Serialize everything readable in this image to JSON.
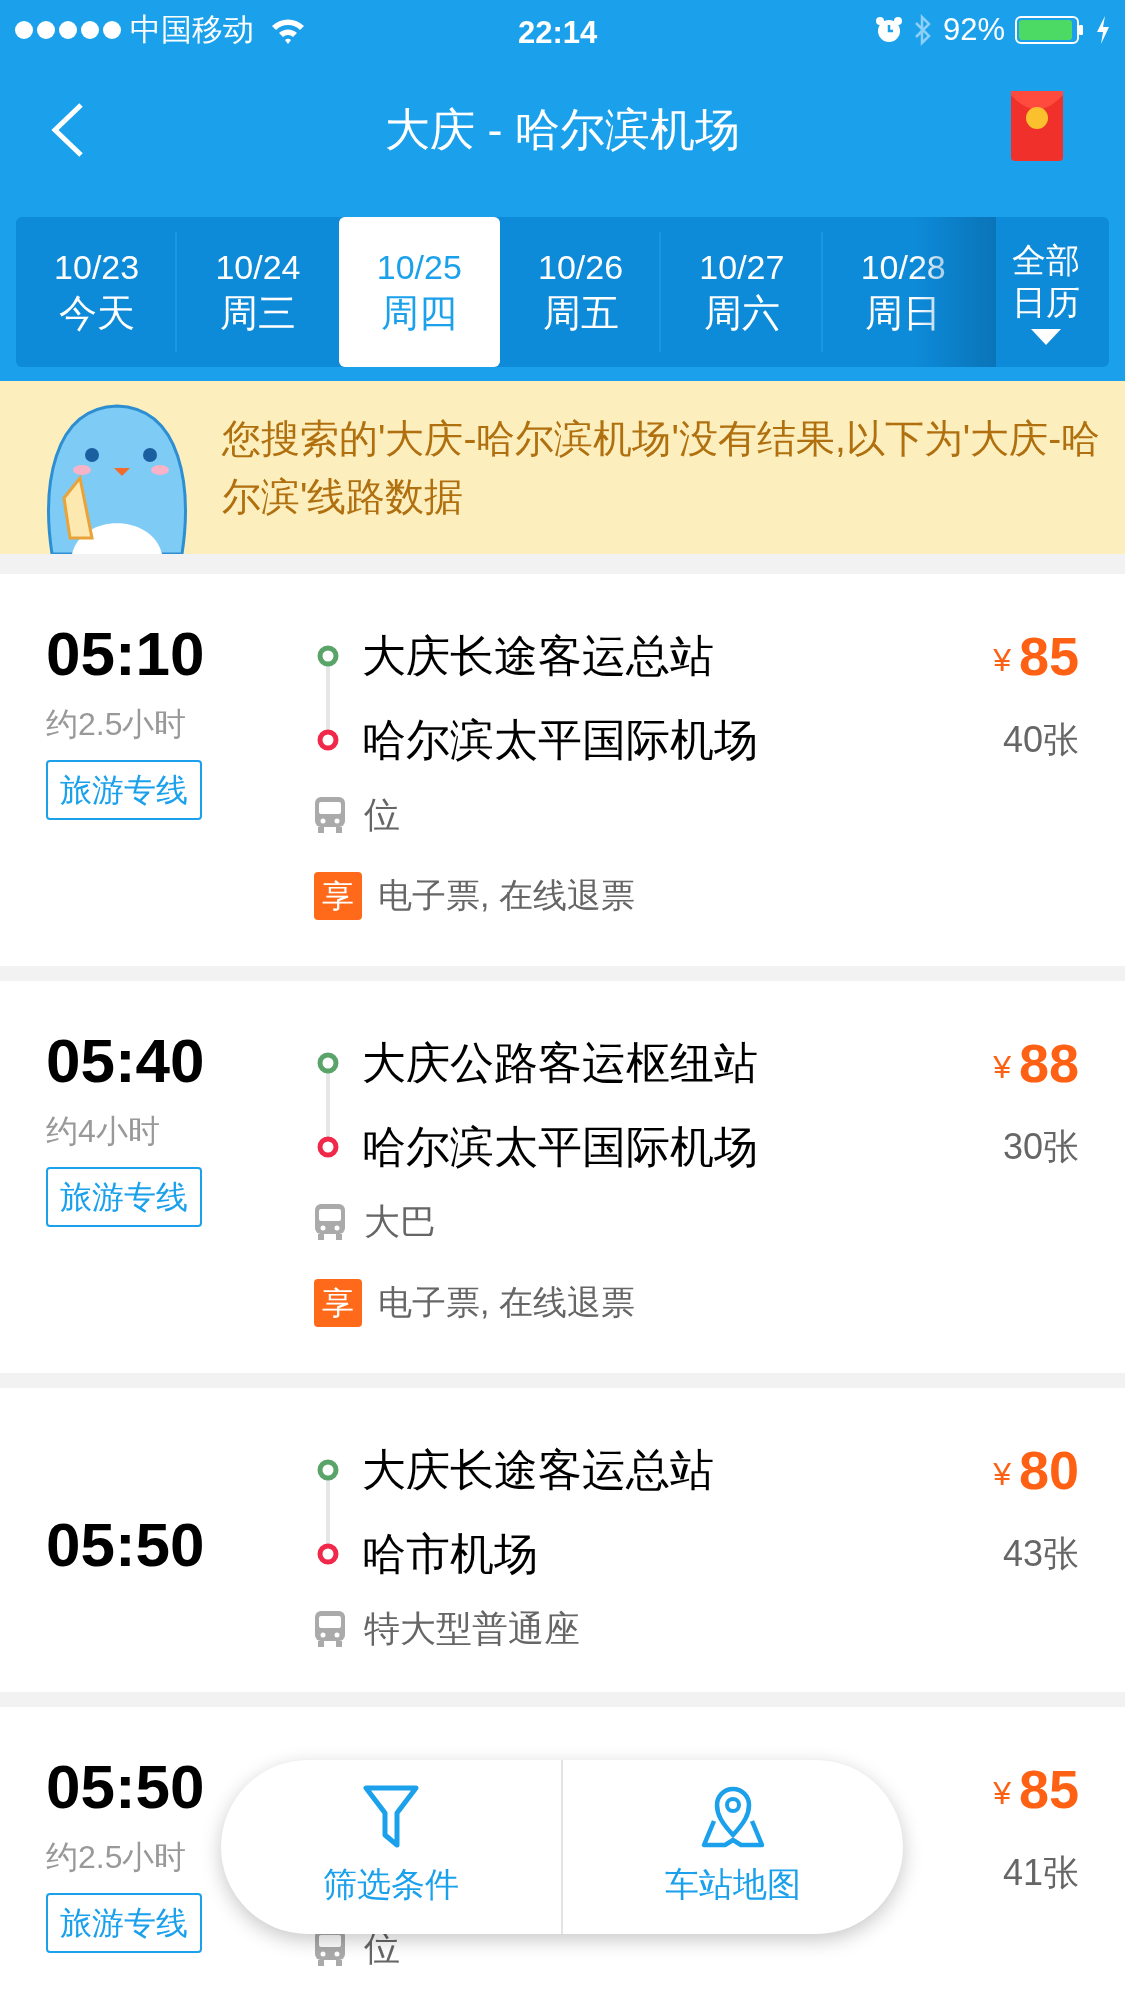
{
  "status_bar": {
    "carrier": "中国移动",
    "time": "22:14",
    "battery": "92%"
  },
  "nav": {
    "title": "大庆 - 哈尔滨机场"
  },
  "dates": [
    {
      "date": "10/23",
      "day": "今天",
      "selected": false
    },
    {
      "date": "10/24",
      "day": "周三",
      "selected": false
    },
    {
      "date": "10/25",
      "day": "周四",
      "selected": true
    },
    {
      "date": "10/26",
      "day": "周五",
      "selected": false
    },
    {
      "date": "10/27",
      "day": "周六",
      "selected": false
    },
    {
      "date": "10/28",
      "day": "周日",
      "selected": false
    }
  ],
  "calendar_button": {
    "line1": "全部",
    "line2": "日历"
  },
  "notice": "您搜索的'大庆-哈尔滨机场'没有结果,以下为'大庆-哈尔滨'线路数据",
  "trips": [
    {
      "time": "05:10",
      "duration": "约2.5小时",
      "tag": "旅游专线",
      "from": "大庆长途客运总站",
      "to": "哈尔滨太平国际机场",
      "bus": "位",
      "perk_badge": "享",
      "perk": "电子票, 在线退票",
      "currency": "¥",
      "price": "85",
      "seats": "40张"
    },
    {
      "time": "05:40",
      "duration": "约4小时",
      "tag": "旅游专线",
      "from": "大庆公路客运枢纽站",
      "to": "哈尔滨太平国际机场",
      "bus": "大巴",
      "perk_badge": "享",
      "perk": "电子票, 在线退票",
      "currency": "¥",
      "price": "88",
      "seats": "30张"
    },
    {
      "time": "05:50",
      "from": "大庆长途客运总站",
      "to": "哈市机场",
      "bus": "特大型普通座",
      "currency": "¥",
      "price": "80",
      "seats": "43张"
    },
    {
      "time": "05:50",
      "duration": "约2.5小时",
      "tag": "旅游专线",
      "bus": "位",
      "currency": "¥",
      "price": "85",
      "seats": "41张"
    }
  ],
  "bottom_bar": {
    "filter": "筛选条件",
    "map": "车站地图"
  }
}
